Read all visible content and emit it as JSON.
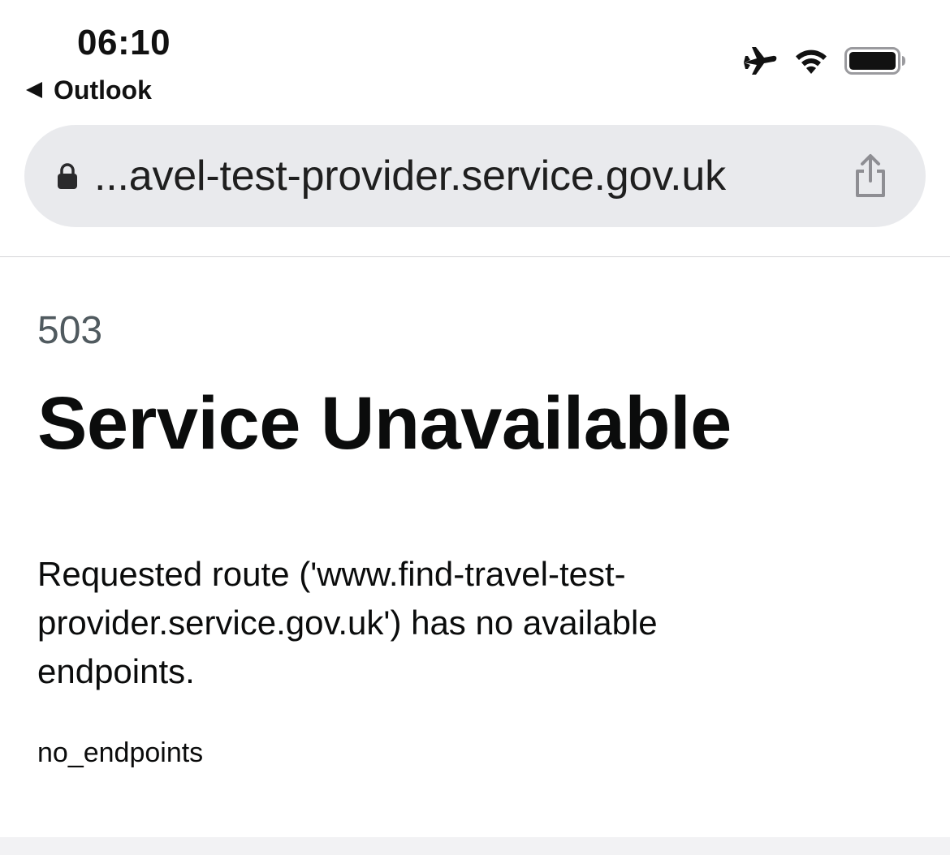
{
  "status_bar": {
    "time": "06:10",
    "back_app_label": "Outlook",
    "icons": [
      "airplane-mode-icon",
      "wifi-icon",
      "battery-icon"
    ]
  },
  "address_bar": {
    "url": "...avel-test-provider.service.gov.uk",
    "icons": [
      "lock-icon",
      "share-icon"
    ]
  },
  "page": {
    "error_code": "503",
    "error_title": "Service Unavailable",
    "message": "Requested route ('www.find-travel-test-provider.service.gov.uk') has no available endpoints.",
    "error_id": "no_endpoints"
  },
  "colors": {
    "address_bar_bg": "#e9eaed",
    "text": "#0b0c0c",
    "secondary_text": "#505a5f"
  }
}
